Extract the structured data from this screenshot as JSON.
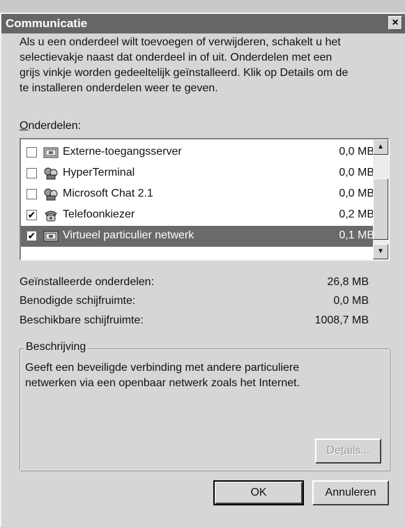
{
  "window": {
    "title": "Communicatie",
    "close_glyph": "×"
  },
  "intro": {
    "line1": "Als u een onderdeel wilt toevoegen of verwijderen, schakelt u het",
    "line2": "selectievakje naast dat onderdeel in of uit. Onderdelen met een",
    "line3": "grijs vinkje worden gedeeltelijk geïnstalleerd. Klik op Details om de",
    "line4": "te installeren onderdelen weer te geven."
  },
  "components": {
    "label_accel": "O",
    "label_rest": "nderdelen:",
    "items": [
      {
        "name": "Externe-toegangsserver",
        "size": "0,0 MB",
        "checked": false,
        "icon": "server-icon"
      },
      {
        "name": "HyperTerminal",
        "size": "0,0 MB",
        "checked": false,
        "icon": "components-icon"
      },
      {
        "name": "Microsoft Chat 2.1",
        "size": "0,0 MB",
        "checked": false,
        "icon": "components-icon"
      },
      {
        "name": "Telefoonkiezer",
        "size": "0,2 MB",
        "checked": true,
        "icon": "phone-icon"
      },
      {
        "name": "Virtueel particulier netwerk",
        "size": "0,1 MB",
        "checked": true,
        "icon": "network-icon",
        "selected": true
      }
    ]
  },
  "stats": {
    "installed_label": "Geïnstalleerde onderdelen:",
    "installed_value": "26,8 MB",
    "required_label": "Benodigde schijfruimte:",
    "required_value": "0,0 MB",
    "available_label": "Beschikbare schijfruimte:",
    "available_value": "1008,7 MB"
  },
  "description": {
    "title": "Beschrijving",
    "line1": "Geeft een beveiligde verbinding met andere particuliere",
    "line2": "netwerken via een openbaar netwerk zoals het Internet."
  },
  "buttons": {
    "details_pre": "De",
    "details_accel": "t",
    "details_post": "ails...",
    "ok": "OK",
    "cancel": "Annuleren"
  }
}
